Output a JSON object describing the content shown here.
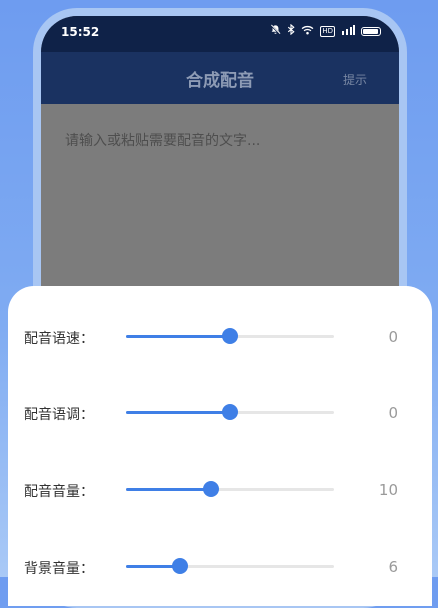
{
  "status_bar": {
    "time": "15:52",
    "icons": [
      "mute-icon",
      "bluetooth-icon",
      "wifi-icon",
      "hd-icon",
      "signal-icon",
      "battery-icon"
    ],
    "hd_label": "HD"
  },
  "app_bar": {
    "title": "合成配音",
    "hint_label": "提示"
  },
  "editor": {
    "placeholder": "请输入或粘贴需要配音的文字..."
  },
  "settings": {
    "accent_color": "#3f7fe6",
    "rows": [
      {
        "label": "配音语速：",
        "value": "0",
        "level": 0.5
      },
      {
        "label": "配音语调：",
        "value": "0",
        "level": 0.5
      },
      {
        "label": "配音音量：",
        "value": "10",
        "level": 0.41
      },
      {
        "label": "背景音量：",
        "value": "6",
        "level": 0.26
      }
    ]
  }
}
